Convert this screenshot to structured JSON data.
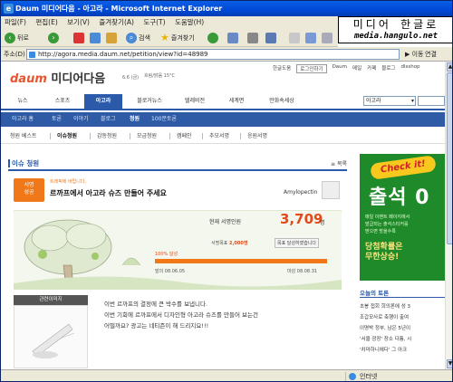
{
  "window": {
    "title": "Daum 미디어다음 - 아고라 - Microsoft Internet Explorer"
  },
  "watermark": {
    "korean": "미디어 한글로",
    "url": "media.hangulo.net"
  },
  "menu": [
    "파일(F)",
    "편집(E)",
    "보기(V)",
    "즐겨찾기(A)",
    "도구(T)",
    "도움말(H)"
  ],
  "toolbar": {
    "back": "뒤로",
    "search": "검색",
    "favorites": "즐겨찾기"
  },
  "address": {
    "label": "주소(D)",
    "url": "http://agora.media.daum.net/petition/view?id=48989",
    "go": "이동",
    "links": "연결"
  },
  "site": {
    "logo_daum": "daum",
    "logo_text": "미디어다음",
    "weather": "6.6 (금)",
    "weather2": "흐림/맑음 15°C",
    "toplinks": [
      "한글도움",
      "로그인하기",
      "Daum",
      "메일",
      "카페",
      "블로그",
      "dlsshop"
    ],
    "search_value": "아고라"
  },
  "nav": [
    "뉴스",
    "스포츠",
    "아고라",
    "블로거뉴스",
    "텔레비전",
    "세계면",
    "만화속세상"
  ],
  "subnav": [
    "아고라 홈",
    "토론",
    "이야기",
    "블로그",
    "청원",
    "100분토론"
  ],
  "subnav2": [
    "청원 베스트",
    "이슈청원",
    "감동청원",
    "모금청원",
    "캠페인",
    "추모서명",
    "응원서명"
  ],
  "section": {
    "title": "이슈 청원",
    "more": "목록"
  },
  "petition": {
    "badge_line1": "서명",
    "badge_line2": "성공",
    "small": "트래픽에 바랍니다.",
    "title": "르까프에서 아고라 슈즈 만들어 주세요",
    "user": "Amylopectin",
    "count_label": "현재 서명인원",
    "count": "3,709",
    "count_unit": "명",
    "goal_label": "서명목표",
    "goal": "2,000명",
    "goal_status": "목표 달성하였습니다",
    "progress_label": "100% 달성",
    "progress": 1.0,
    "start": "발의 08.06.05",
    "end": "마감 08.08.31"
  },
  "related": {
    "header": "관련이미지"
  },
  "description": [
    "이번 르까프의 결정에 큰 박수를 보냅니다.",
    "이번 기회에 르까프에서 디자인형 아고라 슈즈를 만들어 보는건",
    "어떨까요? 광고는 네티즌이 해 드리지요!!!"
  ],
  "ad": {
    "check": "Check it!",
    "big": "출석 0",
    "small": "매일 이벤트 페이지에서\n발급되는 출석스티커를\n받으면 방울수록",
    "stripe": "받으면 방울수록",
    "prize": "당첨확률은\n무한상승!"
  },
  "right_list": {
    "header": "오늘의 토론",
    "items": [
      "초봉 접회 희의론에 성 3",
      "조갑모사로 축행이 출여",
      "이명박 정부, 남은 5년이",
      "'서울 광장' 장소 다툼, 시",
      "'차마하니에다' 그 아크"
    ]
  },
  "status": {
    "zone": "인터넷"
  }
}
